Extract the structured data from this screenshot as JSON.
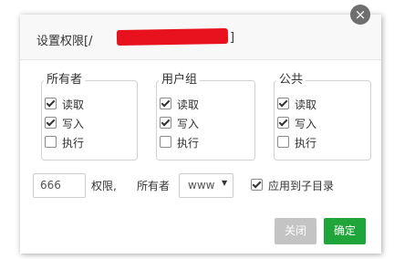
{
  "dialog": {
    "title_prefix": "设置权限[/",
    "title_suffix": "]",
    "close_symbol": "×"
  },
  "groups": [
    {
      "legend": "所有者",
      "options": [
        {
          "label": "读取",
          "checked": true
        },
        {
          "label": "写入",
          "checked": true
        },
        {
          "label": "执行",
          "checked": false
        }
      ]
    },
    {
      "legend": "用户组",
      "options": [
        {
          "label": "读取",
          "checked": true
        },
        {
          "label": "写入",
          "checked": true
        },
        {
          "label": "执行",
          "checked": false
        }
      ]
    },
    {
      "legend": "公共",
      "options": [
        {
          "label": "读取",
          "checked": true
        },
        {
          "label": "写入",
          "checked": true
        },
        {
          "label": "执行",
          "checked": false
        }
      ]
    }
  ],
  "permission": {
    "value": "666",
    "label": "权限,"
  },
  "owner": {
    "label": "所有者",
    "selected": "www"
  },
  "apply_subdir": {
    "label": "应用到子目录",
    "checked": true
  },
  "buttons": {
    "close": "关闭",
    "confirm": "确定"
  },
  "colors": {
    "confirm_bg": "#20a53a",
    "close_bg": "#c4c4c4",
    "redaction": "#e8121e"
  }
}
